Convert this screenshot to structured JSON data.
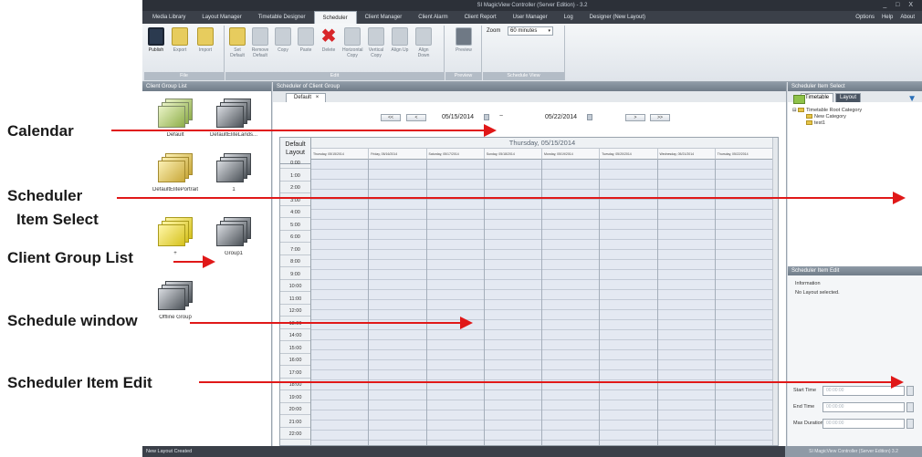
{
  "window": {
    "title": "SI MagicView Controller (Server Edition) - 3.2",
    "controls": "_ □ X"
  },
  "menu": {
    "items": [
      "Media Library",
      "Layout Manager",
      "Timetable Designer",
      "Scheduler",
      "Client Manager",
      "Client Alarm",
      "Client Report",
      "User Manager",
      "Log",
      "Designer (New Layout)"
    ],
    "active": "Scheduler",
    "right_items": [
      "Options",
      "Help",
      "About"
    ]
  },
  "ribbon": {
    "groups": [
      {
        "caption": "File",
        "buttons": [
          "Publish",
          "Export",
          "Import"
        ]
      },
      {
        "caption": "Edit",
        "buttons": [
          "Set Default",
          "Remove Default",
          "Copy",
          "Paste",
          "Delete",
          "Horizontal Copy",
          "Vertical Copy",
          "Align Up",
          "Align Down"
        ]
      },
      {
        "caption": "Preview",
        "buttons": [
          "Preview"
        ]
      },
      {
        "caption": "Schedule View",
        "buttons": []
      }
    ],
    "zoom_label": "Zoom",
    "zoom_value": "60 minutes"
  },
  "client_group_list": {
    "header": "Client Group List",
    "items": [
      {
        "label": "Default",
        "style": "green"
      },
      {
        "label": "DefaultEliteLands...",
        "style": "gray"
      },
      {
        "label": "DefaultElitePortrait",
        "style": "yellow2"
      },
      {
        "label": "1",
        "style": "gray"
      },
      {
        "label": "+",
        "style": "yellow"
      },
      {
        "label": "Group1",
        "style": "gray"
      },
      {
        "label": "Offline Group",
        "style": "gray"
      }
    ]
  },
  "schedule": {
    "header": "Scheduler of Client Group",
    "tab_label": "Default",
    "tab_close": "×",
    "nav": {
      "prev_far": "<<",
      "prev": "<",
      "start_date": "05/15/2014",
      "separator": "~",
      "end_date": "05/22/2014",
      "next": ">",
      "next_far": ">>"
    },
    "layout_label_1": "Default",
    "layout_label_2": "Layout",
    "day_title": "Thursday, 05/15/2014",
    "day_columns": [
      "Thursday, 05/15/2014",
      "Friday, 05/16/2014",
      "Saturday, 05/17/2014",
      "Sunday, 05/18/2014",
      "Monday, 05/19/2014",
      "Tuesday, 05/20/2014",
      "Wednesday, 05/21/2014",
      "Thursday, 05/22/2014"
    ],
    "times": [
      "0:00",
      "1:00",
      "2:00",
      "3:00",
      "4:00",
      "5:00",
      "6:00",
      "7:00",
      "8:00",
      "9:00",
      "10:00",
      "11:00",
      "12:00",
      "13:00",
      "14:00",
      "15:00",
      "16:00",
      "17:00",
      "18:00",
      "19:00",
      "20:00",
      "21:00",
      "22:00"
    ]
  },
  "scheduler_item_select": {
    "header": "Scheduler Item Select",
    "tabs": [
      "Timetable",
      "Layout"
    ],
    "active_tab": "Layout",
    "tree": [
      "Timetable Root Category",
      "New Category",
      "test1"
    ]
  },
  "scheduler_item_edit": {
    "header": "Scheduler Item Edit",
    "info_label": "Information",
    "info_text": "No Layout selected.",
    "start_time_label": "Start Time",
    "start_time_value": "00:00:00",
    "end_time_label": "End Time",
    "end_time_value": "00:00:00",
    "max_duration_label": "Max Duration",
    "max_duration_value": "00:00:00"
  },
  "status": {
    "left": "New Layout Created",
    "right": "SI MagicView Controller (Server Edition) 3.2"
  },
  "annotations": {
    "calendar": "Calendar",
    "scheduler_item_select_1": "Scheduler",
    "scheduler_item_select_2": "Item Select",
    "client_group_list": "Client Group List",
    "schedule_window": "Schedule window",
    "scheduler_item_edit": "Scheduler Item Edit"
  },
  "colors": {
    "arrow": "#e01818",
    "dark_chrome": "#3b4049",
    "grid_cell": "#e4e9f2"
  }
}
